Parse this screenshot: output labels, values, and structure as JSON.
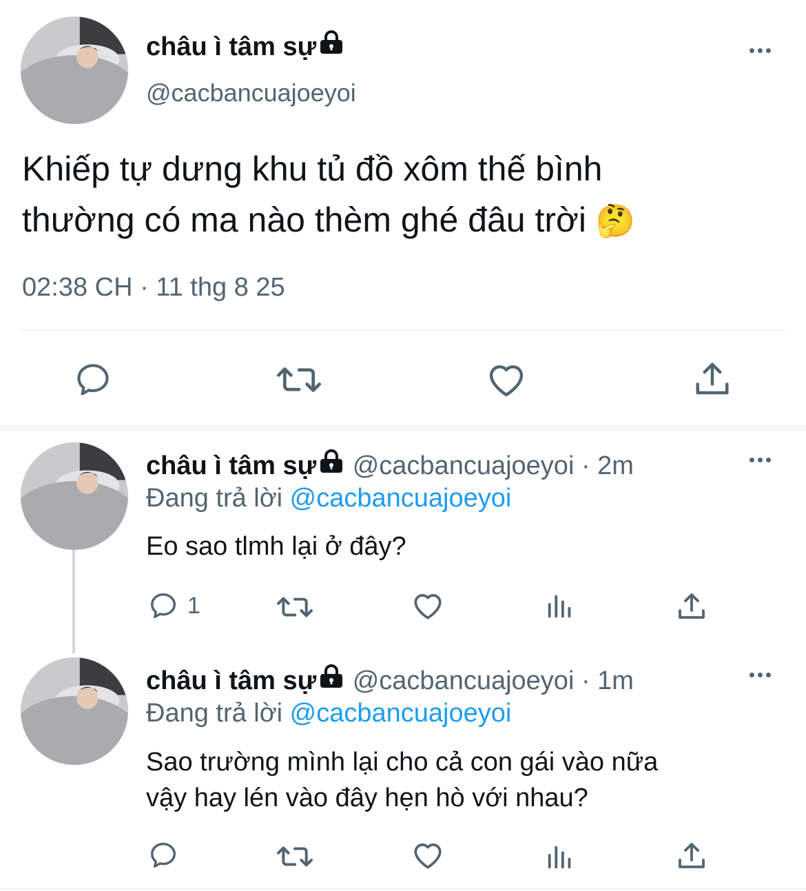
{
  "main_tweet": {
    "display_name": "châu ì tâm sự",
    "handle": "@cacbancuajoeyoi",
    "text_line1": "Khiếp tự dưng khu tủ đồ xôm thế bình",
    "text_line2": "thường có ma nào thèm ghé đâu trời",
    "emoji": "🤔",
    "timestamp": "02:38 CH · 11 thg 8 25",
    "icons": [
      "reply-icon",
      "retweet-icon",
      "like-icon",
      "share-icon"
    ]
  },
  "replies": [
    {
      "display_name": "châu ì tâm sự",
      "handle": "@cacbancuajoeyoi",
      "time": "· 2m",
      "replying_label": "Đang trả lời",
      "replying_to": "@cacbancuajoeyoi",
      "text_line1": "Eo sao tlmh lại ở đây?",
      "text_line2": "",
      "reply_count": "1"
    },
    {
      "display_name": "châu ì tâm sự",
      "handle": "@cacbancuajoeyoi",
      "time": "· 1m",
      "replying_label": "Đang trả lời",
      "replying_to": "@cacbancuajoeyoi",
      "text_line1": "Sao trường mình lại cho cả con gái vào nữa",
      "text_line2": "vậy hay lén vào đây hẹn hò với nhau?",
      "reply_count": ""
    }
  ],
  "colors": {
    "text": "#0f1419",
    "secondary": "#536471",
    "accent": "#1d9bf0",
    "divider": "#eff3f4"
  }
}
